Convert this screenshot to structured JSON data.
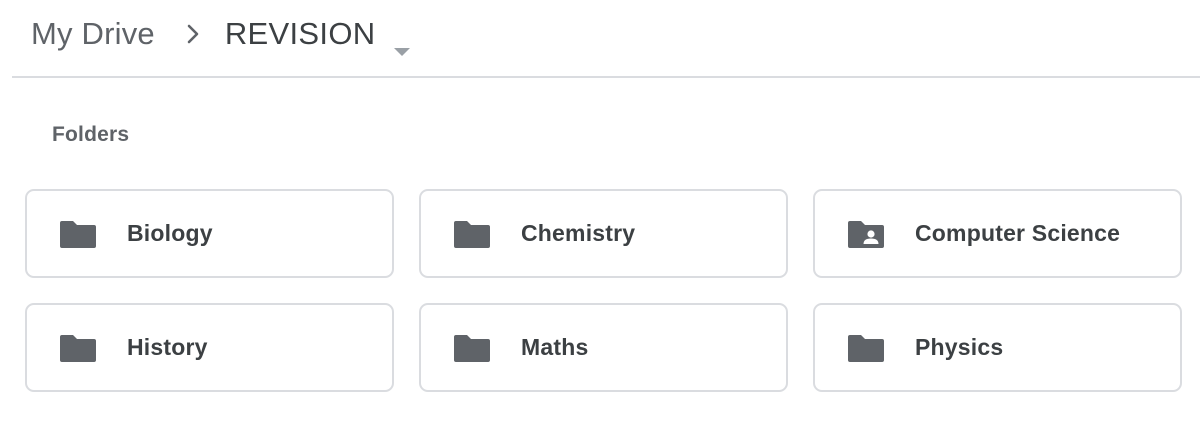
{
  "breadcrumb": {
    "root": "My Drive",
    "current": "REVISION",
    "separator_icon": "chevron-right-icon",
    "dropdown_icon": "caret-down-icon"
  },
  "section": {
    "title": "Folders"
  },
  "folders": [
    {
      "name": "Biology",
      "icon": "folder-icon"
    },
    {
      "name": "Chemistry",
      "icon": "folder-icon"
    },
    {
      "name": "Computer Science",
      "icon": "shared-folder-icon"
    },
    {
      "name": "History",
      "icon": "folder-icon"
    },
    {
      "name": "Maths",
      "icon": "folder-icon"
    },
    {
      "name": "Physics",
      "icon": "folder-icon"
    }
  ],
  "colors": {
    "icon": "#5f6368",
    "text": "#3c4043",
    "border": "#dadce0"
  }
}
